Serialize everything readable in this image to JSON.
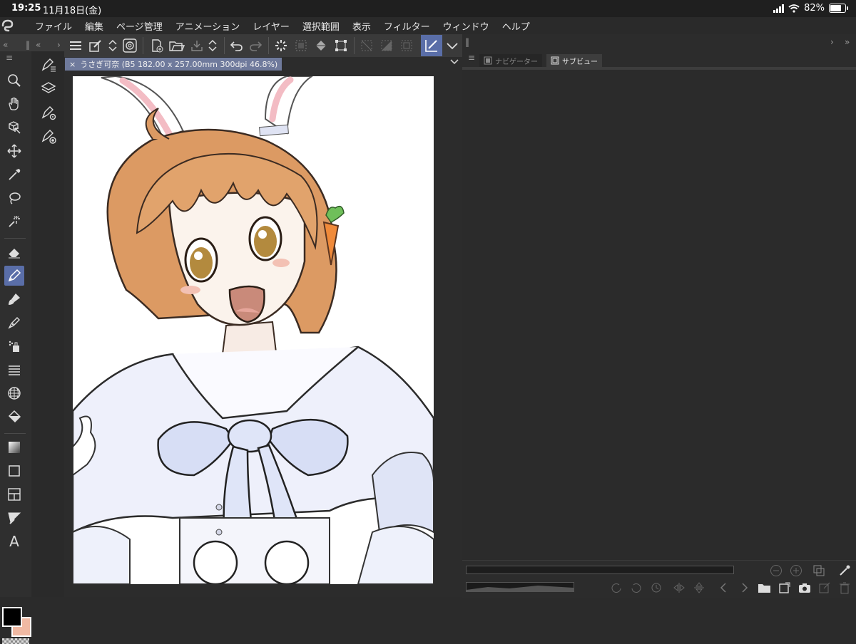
{
  "status": {
    "time": "19:25",
    "date": "11月18日(金)",
    "battery": "82%",
    "battery_level": 0.82
  },
  "menu": {
    "items": [
      "ファイル",
      "編集",
      "ページ管理",
      "アニメーション",
      "レイヤー",
      "選択範囲",
      "表示",
      "フィルター",
      "ウィンドウ",
      "ヘルプ"
    ]
  },
  "document": {
    "tab_title": "うさぎ可奈 (B5 182.00 x 257.00mm 300dpi 46.8%)",
    "close_glyph": "×"
  },
  "right_panel": {
    "tab_navigator": "ナビゲーター",
    "tab_subview": "サブビュー"
  },
  "colors": {
    "accent": "#5a6ea8",
    "main_color": "#000000",
    "sub_color": "#f0b9a3"
  },
  "icons": {
    "tools": [
      "zoom-icon",
      "hand-icon",
      "operation-icon",
      "move-icon",
      "eyedropper-icon",
      "lasso-icon",
      "auto-select-icon",
      "eraser-icon",
      "pen-icon",
      "brush-icon",
      "airbrush-icon",
      "decoration-icon",
      "ruler-icon",
      "perspective-icon",
      "fill-icon",
      "gradient-icon",
      "figure-icon",
      "frame-icon",
      "line-icon",
      "text-icon"
    ]
  }
}
